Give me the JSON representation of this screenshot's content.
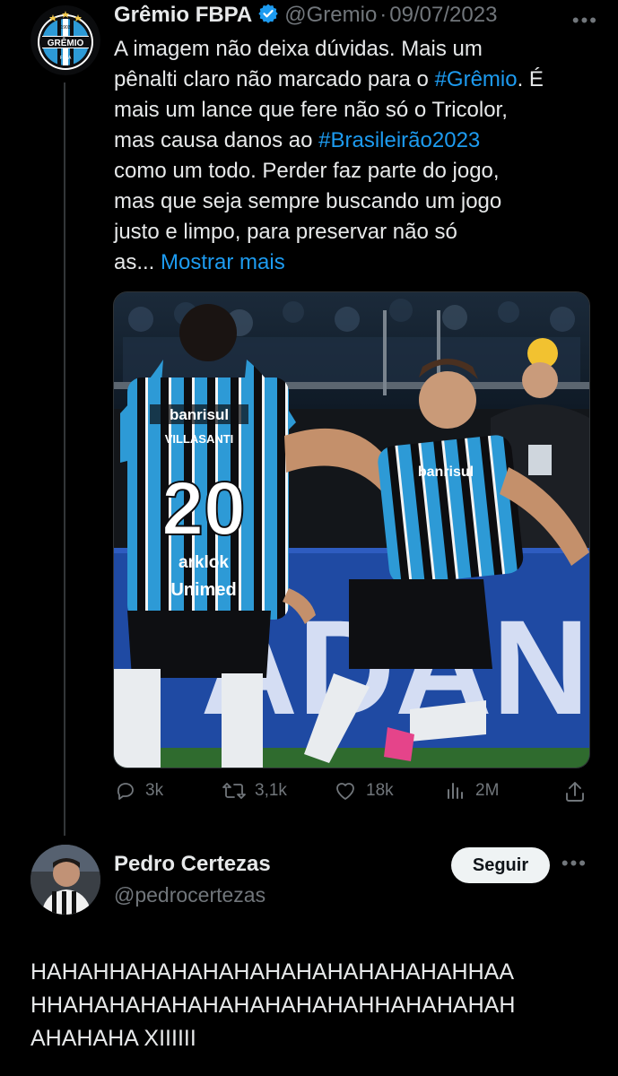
{
  "tweet": {
    "author_name": "Grêmio FBPA",
    "handle": "@Gremio",
    "separator": "·",
    "date": "09/07/2023",
    "lines": [
      [
        "A imagem não deixa dúvidas. Mais um"
      ],
      [
        "pênalti claro não marcado para o ",
        "#Grêmio",
        ". É"
      ],
      [
        "mais um lance que fere não só o Tricolor,"
      ],
      [
        "mas causa danos ao ",
        "#Brasileirão2023"
      ],
      [
        "como um todo. Perder faz parte do jogo,"
      ],
      [
        "mas que seja sempre buscando um jogo"
      ],
      [
        "justo e limpo, para preservar não só"
      ],
      [
        "as... ",
        "Mostrar mais"
      ]
    ],
    "line1": "A imagem não deixa dúvidas. Mais um",
    "line2_a": "pênalti claro não marcado para o ",
    "hashtag1": "#Grêmio",
    "line2_b": ". É",
    "line3": "mais um lance que fere não só o Tricolor,",
    "line4_a": "mas causa danos ao ",
    "hashtag2": "#Brasileirão2023",
    "line5": "como um todo. Perder faz parte do jogo,",
    "line6": "mas que seja sempre buscando um jogo",
    "line7": "justo e limpo, para preservar não só",
    "line8_a": "as... ",
    "show_more": "Mostrar mais",
    "avatar_badge": {
      "year": "1903",
      "name": "GRÊMIO",
      "abbr": "FBPA"
    },
    "media": {
      "player1_sponsor": "banrisul",
      "player1_name": "VILLASANTI",
      "player1_number": "20",
      "player1_sponsor2": "arklok",
      "player1_sponsor3": "Unimed",
      "player2_sponsor": "banrisul",
      "board_text": "ADAN"
    },
    "stats": {
      "replies": "3k",
      "retweets": "3,1k",
      "likes": "18k",
      "views": "2M"
    },
    "colors": {
      "link": "#1d9bf0",
      "verified": "#1d9bf0",
      "gremio_blue": "#2d9ad6"
    }
  },
  "reply": {
    "author_name": "Pedro Certezas",
    "handle": "@pedrocertezas",
    "follow_label": "Seguir",
    "line1": "HAHAHHAHAHAHAHAHAHAHAHAHAHAHHAA",
    "line2": "HHAHAHAHAHAHAHAHAHAHAHHAHAHAHAH",
    "line3": "AHAHAHA XIIIIII"
  },
  "icons": {
    "verified": "verified-badge-icon",
    "more": "more-dots-icon",
    "reply": "reply-icon",
    "retweet": "retweet-icon",
    "like": "heart-icon",
    "views": "views-icon",
    "share": "share-icon"
  }
}
